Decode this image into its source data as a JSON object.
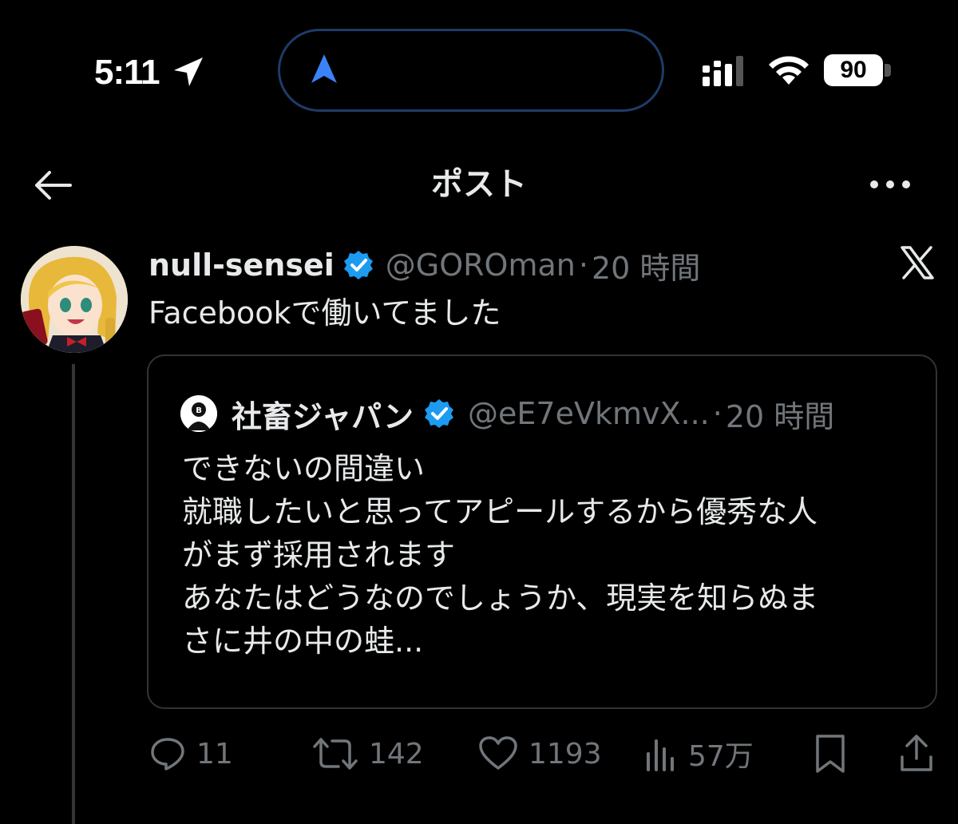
{
  "status_bar": {
    "time": "5:11",
    "battery": "90"
  },
  "header": {
    "title": "ポスト"
  },
  "post": {
    "author_name": "null-sensei",
    "handle": "@GOROman",
    "separator": "·",
    "time": "20 時間",
    "text": "Facebookで働いてました"
  },
  "quote": {
    "author_name": "社畜ジャパン",
    "handle": "@eE7eVkmvX...",
    "separator": "·",
    "time": "20 時間",
    "lines": [
      "できないの間違い",
      "就職したいと思ってアピールするから優秀な人",
      "がまず採用されます",
      "あなたはどうなのでしょうか、現実を知らぬま",
      "さに井の中の蛙..."
    ]
  },
  "actions": {
    "replies": "11",
    "reposts": "142",
    "likes": "1193",
    "views": "57万"
  },
  "colors": {
    "background": "#000000",
    "text": "#e7e9ea",
    "muted": "#71767b",
    "verified": "#1d9bf0",
    "border": "#2f3336"
  },
  "icons": [
    "location-arrow-icon",
    "navigation-icon",
    "signal-icon",
    "wifi-icon",
    "battery-icon",
    "back-arrow-icon",
    "more-icon",
    "verified-badge-icon",
    "x-logo-icon",
    "reply-icon",
    "repost-icon",
    "like-icon",
    "views-icon",
    "bookmark-icon",
    "share-icon"
  ]
}
